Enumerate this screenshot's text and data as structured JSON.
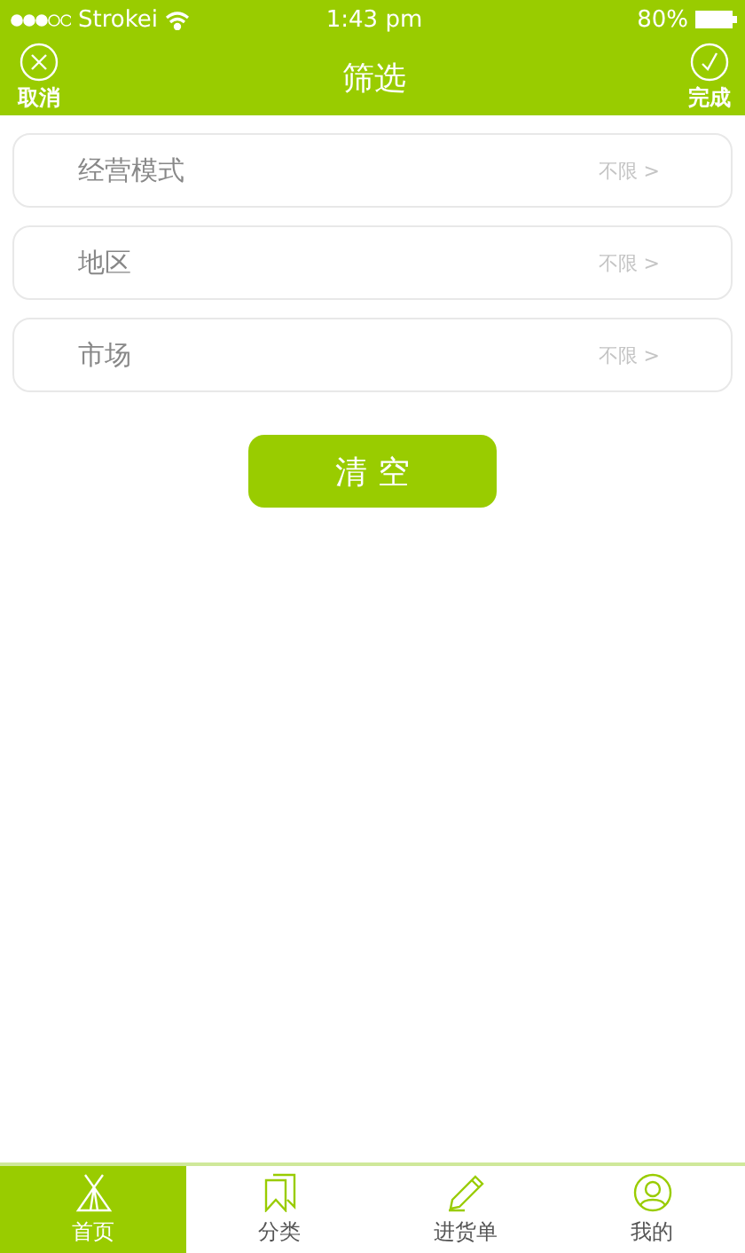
{
  "status_bar": {
    "carrier": "Strokei",
    "time": "1:43 pm",
    "battery": "80%"
  },
  "nav": {
    "cancel": "取消",
    "title": "筛选",
    "done": "完成"
  },
  "filters": [
    {
      "label": "经营模式",
      "value": "不限 >"
    },
    {
      "label": "地区",
      "value": "不限 >"
    },
    {
      "label": "市场",
      "value": "不限 >"
    }
  ],
  "clear_button": "清 空",
  "tab_bar": [
    {
      "label": "首页",
      "selected": true
    },
    {
      "label": "分类",
      "selected": false
    },
    {
      "label": "进货单",
      "selected": false
    },
    {
      "label": "我的",
      "selected": false
    }
  ]
}
